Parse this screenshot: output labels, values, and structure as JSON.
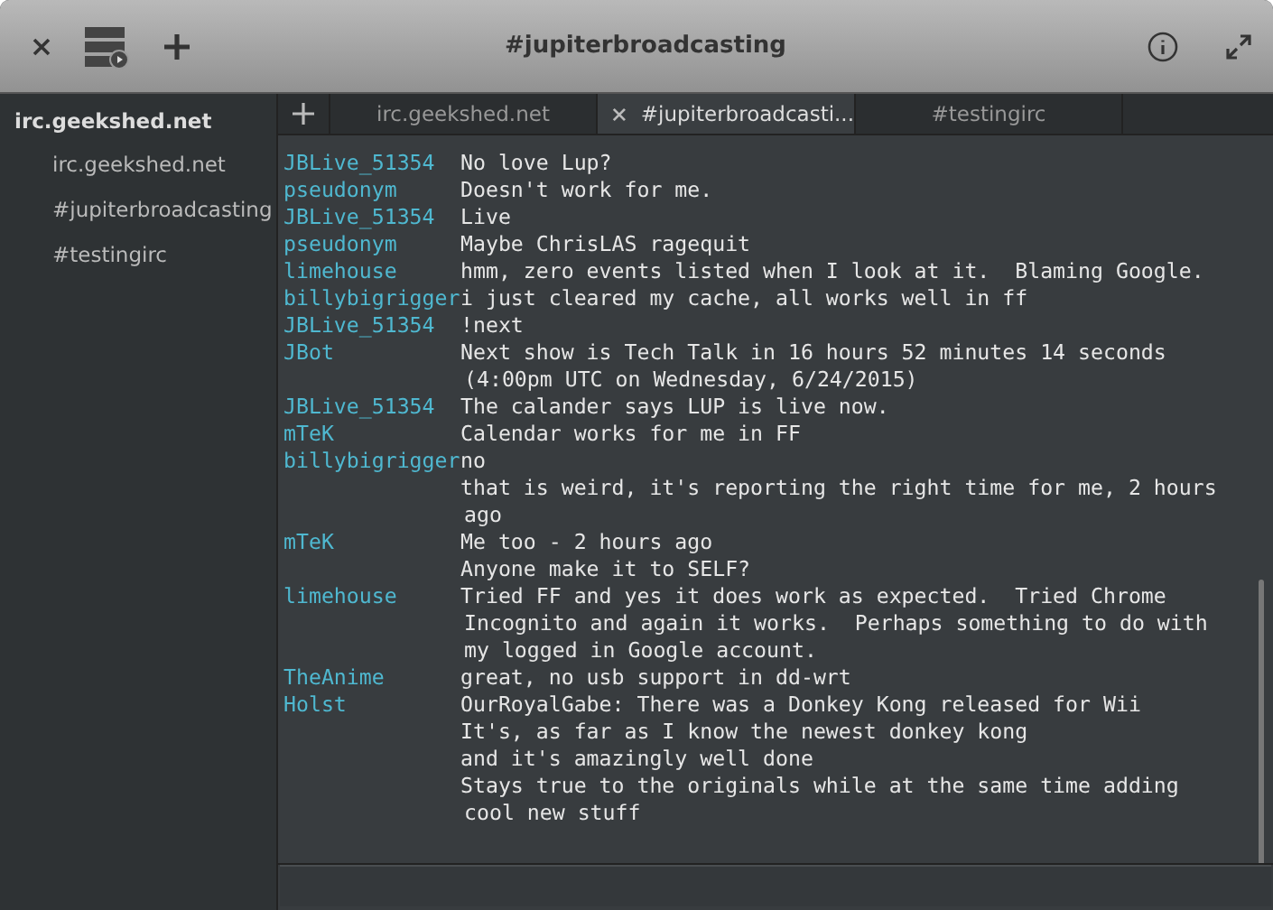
{
  "window": {
    "title": "#jupiterbroadcasting"
  },
  "sidebar": {
    "server": "irc.geekshed.net",
    "items": [
      {
        "label": "irc.geekshed.net",
        "selected": false
      },
      {
        "label": "#jupiterbroadcasting",
        "selected": false
      },
      {
        "label": "#testingirc",
        "selected": false
      }
    ]
  },
  "tabs": [
    {
      "label": "irc.geekshed.net",
      "selected": false
    },
    {
      "label": "#jupiterbroadcasti...",
      "selected": true
    },
    {
      "label": "#testingirc",
      "selected": false
    }
  ],
  "messages": [
    {
      "nick": "JBLive_51354",
      "lines": [
        "No love Lup?"
      ]
    },
    {
      "nick": "pseudonym",
      "lines": [
        "Doesn't work for me."
      ]
    },
    {
      "nick": "JBLive_51354",
      "lines": [
        "Live"
      ]
    },
    {
      "nick": "pseudonym",
      "lines": [
        "Maybe ChrisLAS ragequit"
      ]
    },
    {
      "nick": "limehouse",
      "lines": [
        "hmm, zero events listed when I look at it.  Blaming Google."
      ]
    },
    {
      "nick": "billybigrigger",
      "lines": [
        "i just cleared my cache, all works well in ff"
      ]
    },
    {
      "nick": "JBLive_51354",
      "lines": [
        "!next"
      ]
    },
    {
      "nick": "JBot",
      "lines": [
        "Next show is Tech Talk in 16 hours 52 minutes 14 seconds",
        "(4:00pm UTC on Wednesday, 6/24/2015)"
      ]
    },
    {
      "nick": "JBLive_51354",
      "lines": [
        "The calander says LUP is live now."
      ]
    },
    {
      "nick": "mTeK",
      "lines": [
        "Calendar works for me in FF"
      ]
    },
    {
      "nick": "billybigrigger",
      "lines": [
        "no"
      ]
    },
    {
      "lines": [
        "that is weird, it's reporting the right time for me, 2 hours",
        "ago"
      ]
    },
    {
      "nick": "mTeK",
      "lines": [
        "Me too - 2 hours ago"
      ]
    },
    {
      "lines": [
        "Anyone make it to SELF?"
      ]
    },
    {
      "nick": "limehouse",
      "lines": [
        "Tried FF and yes it does work as expected.  Tried Chrome",
        "Incognito and again it works.  Perhaps something to do with",
        "my logged in Google account."
      ]
    },
    {
      "nick": "TheAnime",
      "lines": [
        "great, no usb support in dd-wrt"
      ]
    },
    {
      "nick": "Holst",
      "lines": [
        "OurRoyalGabe: There was a Donkey Kong released for Wii"
      ]
    },
    {
      "lines": [
        "It's, as far as I know the newest donkey kong"
      ]
    },
    {
      "lines": [
        "and it's amazingly well done"
      ]
    },
    {
      "lines": [
        "Stays true to the originals while at the same time adding",
        "cool new stuff"
      ]
    }
  ]
}
